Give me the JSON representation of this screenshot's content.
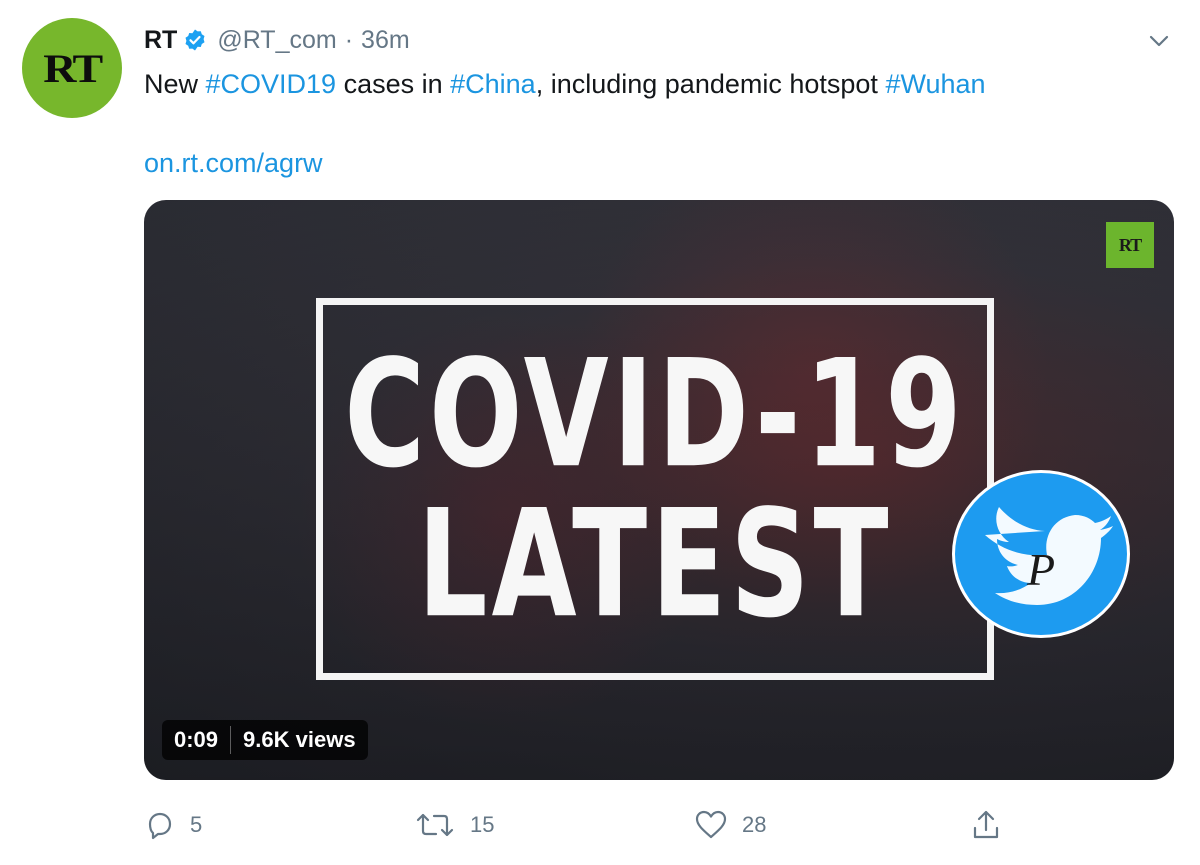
{
  "tweet": {
    "avatar_text": "RT",
    "display_name": "RT",
    "handle": "@RT_com",
    "separator": "·",
    "time": "36m",
    "text": {
      "p1": "New ",
      "tag1": "#COVID19",
      "p2": " cases in ",
      "tag2": "#China",
      "p3": ", including pandemic hotspot ",
      "tag3": "#Wuhan"
    },
    "link": "on.rt.com/agrw"
  },
  "media": {
    "corner_badge": "RT",
    "title_line1": "COVID-19",
    "title_line2": "LATEST",
    "duration": "0:09",
    "views": "9.6K views",
    "watermark_icon": "twitter-bird-icon"
  },
  "actions": {
    "reply_count": "5",
    "retweet_count": "15",
    "like_count": "28"
  },
  "colors": {
    "link_blue": "#1b95e0",
    "rt_green": "#77b72c",
    "muted": "#657786",
    "twitter_blue": "#1d9bf0"
  }
}
